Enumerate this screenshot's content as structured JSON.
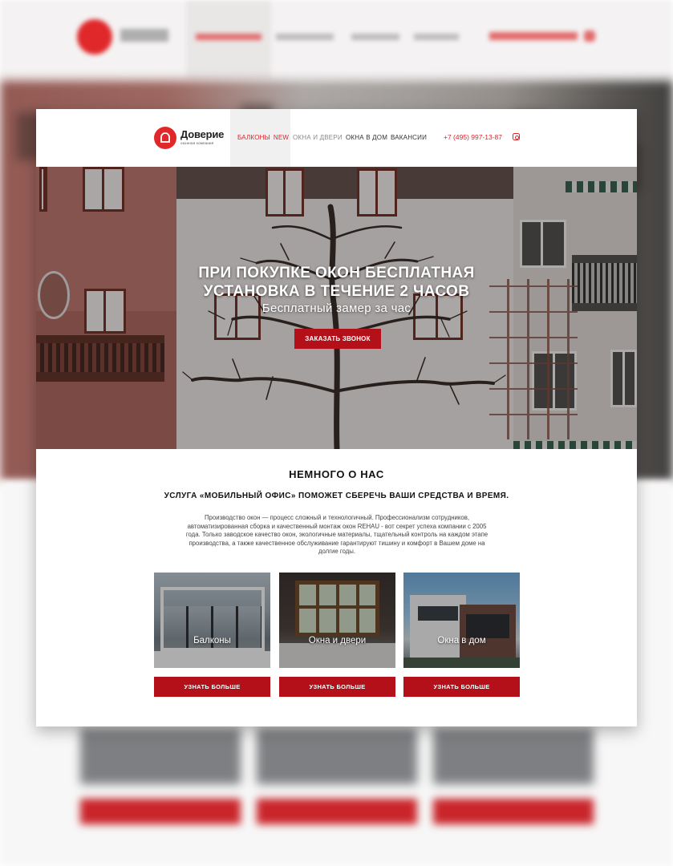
{
  "header": {
    "logo_name": "Доверие",
    "logo_sub": "оконная компания",
    "nav": [
      {
        "label": "БАЛКОНЫ",
        "badge": "NEW",
        "state": "active"
      },
      {
        "label": "ОКНА И ДВЕРИ",
        "state": "muted"
      },
      {
        "label": "ОКНА В ДОМ",
        "state": "normal"
      },
      {
        "label": "ВАКАНСИИ",
        "state": "normal"
      }
    ],
    "phone": "+7 (495) 997-13-87",
    "social_icon": "instagram-icon"
  },
  "hero": {
    "title_line1": "ПРИ ПОКУПКЕ ОКОН БЕСПЛАТНАЯ",
    "title_line2": "УСТАНОВКА В ТЕЧЕНИЕ 2 ЧАСОВ",
    "subtitle": "Бесплатный замер за час",
    "cta": "ЗАКАЗАТЬ ЗВОНОК"
  },
  "about": {
    "title": "НЕМНОГО О НАС",
    "subtitle": "УСЛУГА «МОБИЛЬНЫЙ ОФИС» ПОМОЖЕТ СБЕРЕЧЬ ВАШИ СРЕДСТВА И ВРЕМЯ.",
    "text_lines": [
      "Производство окон — процесс сложный и технологичный. Профессионализм сотрудников,",
      "автоматизированная сборка и качественный монтаж окон REHAU - вот секрет успеха компании с 2005",
      "года. Только заводское качество окон, экологичные материалы, тщательный контроль на каждом этапе",
      "производства, а также качественное обслуживание гарантируют тишину и комфорт в Вашем доме на",
      "долгие годы."
    ]
  },
  "services": [
    {
      "label": "Балконы",
      "button": "УЗНАТЬ БОЛЬШЕ"
    },
    {
      "label": "Окна и двери",
      "button": "УЗНАТЬ БОЛЬШЕ"
    },
    {
      "label": "Окна в дом",
      "button": "УЗНАТЬ БОЛЬШЕ"
    }
  ],
  "colors": {
    "accent": "#d9262b",
    "button": "#b31019",
    "nav_active_bg": "#f0f0f0"
  }
}
